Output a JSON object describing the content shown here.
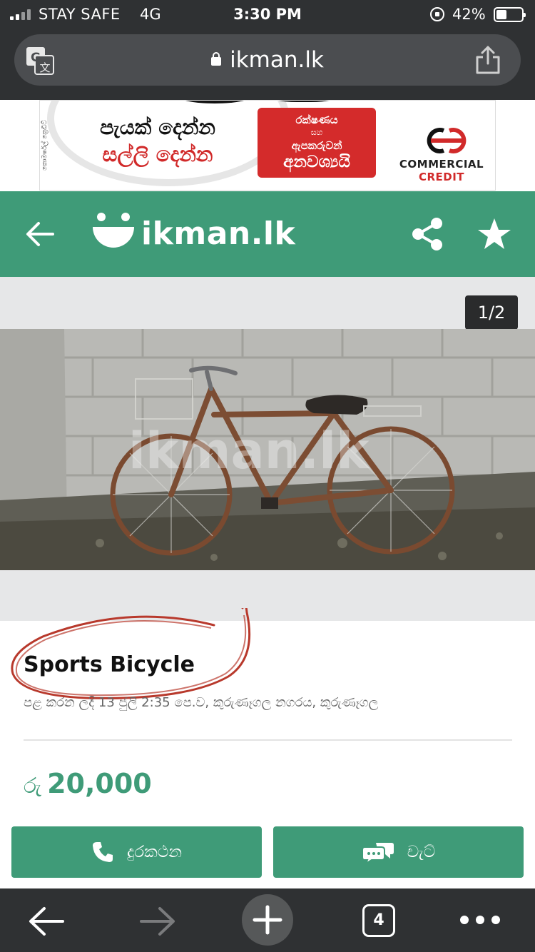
{
  "status_bar": {
    "carrier": "STAY SAFE",
    "network": "4G",
    "time": "3:30 PM",
    "battery_percent": "42%"
  },
  "browser": {
    "url": "ikman.lk",
    "open_tabs": "4"
  },
  "ad": {
    "line1": "පැයක් දෙන්න",
    "line2": "සල්ලි දෙන්න",
    "box_line1": "රක්ෂණය",
    "box_line2": "සහ",
    "box_line3": "ඇපකරුවන්",
    "box_line4": "අනවශ්‍යයි",
    "brand_line1": "COMMERCIAL",
    "brand_line2": "CREDIT",
    "vertical_text": "කොමර්ෂල් ක්‍රෙඩිට්"
  },
  "header": {
    "brand": "ikman.lk"
  },
  "gallery": {
    "counter": "1/2",
    "watermark": "ikman.lk"
  },
  "listing": {
    "title": "Sports Bicycle",
    "meta": "පළ කරන ලදි 13 ජුලි 2:35 පෙ.ව, කුරුණෑගල නගරය, කුරුණෑගල",
    "currency": "රු",
    "price": "20,000"
  },
  "actions": {
    "call_label": "දුරකථන",
    "chat_label": "චැට්"
  },
  "colors": {
    "brand_green": "#3f9b78",
    "browser_dark": "#2f3133",
    "annotation_red": "#b8392c"
  }
}
